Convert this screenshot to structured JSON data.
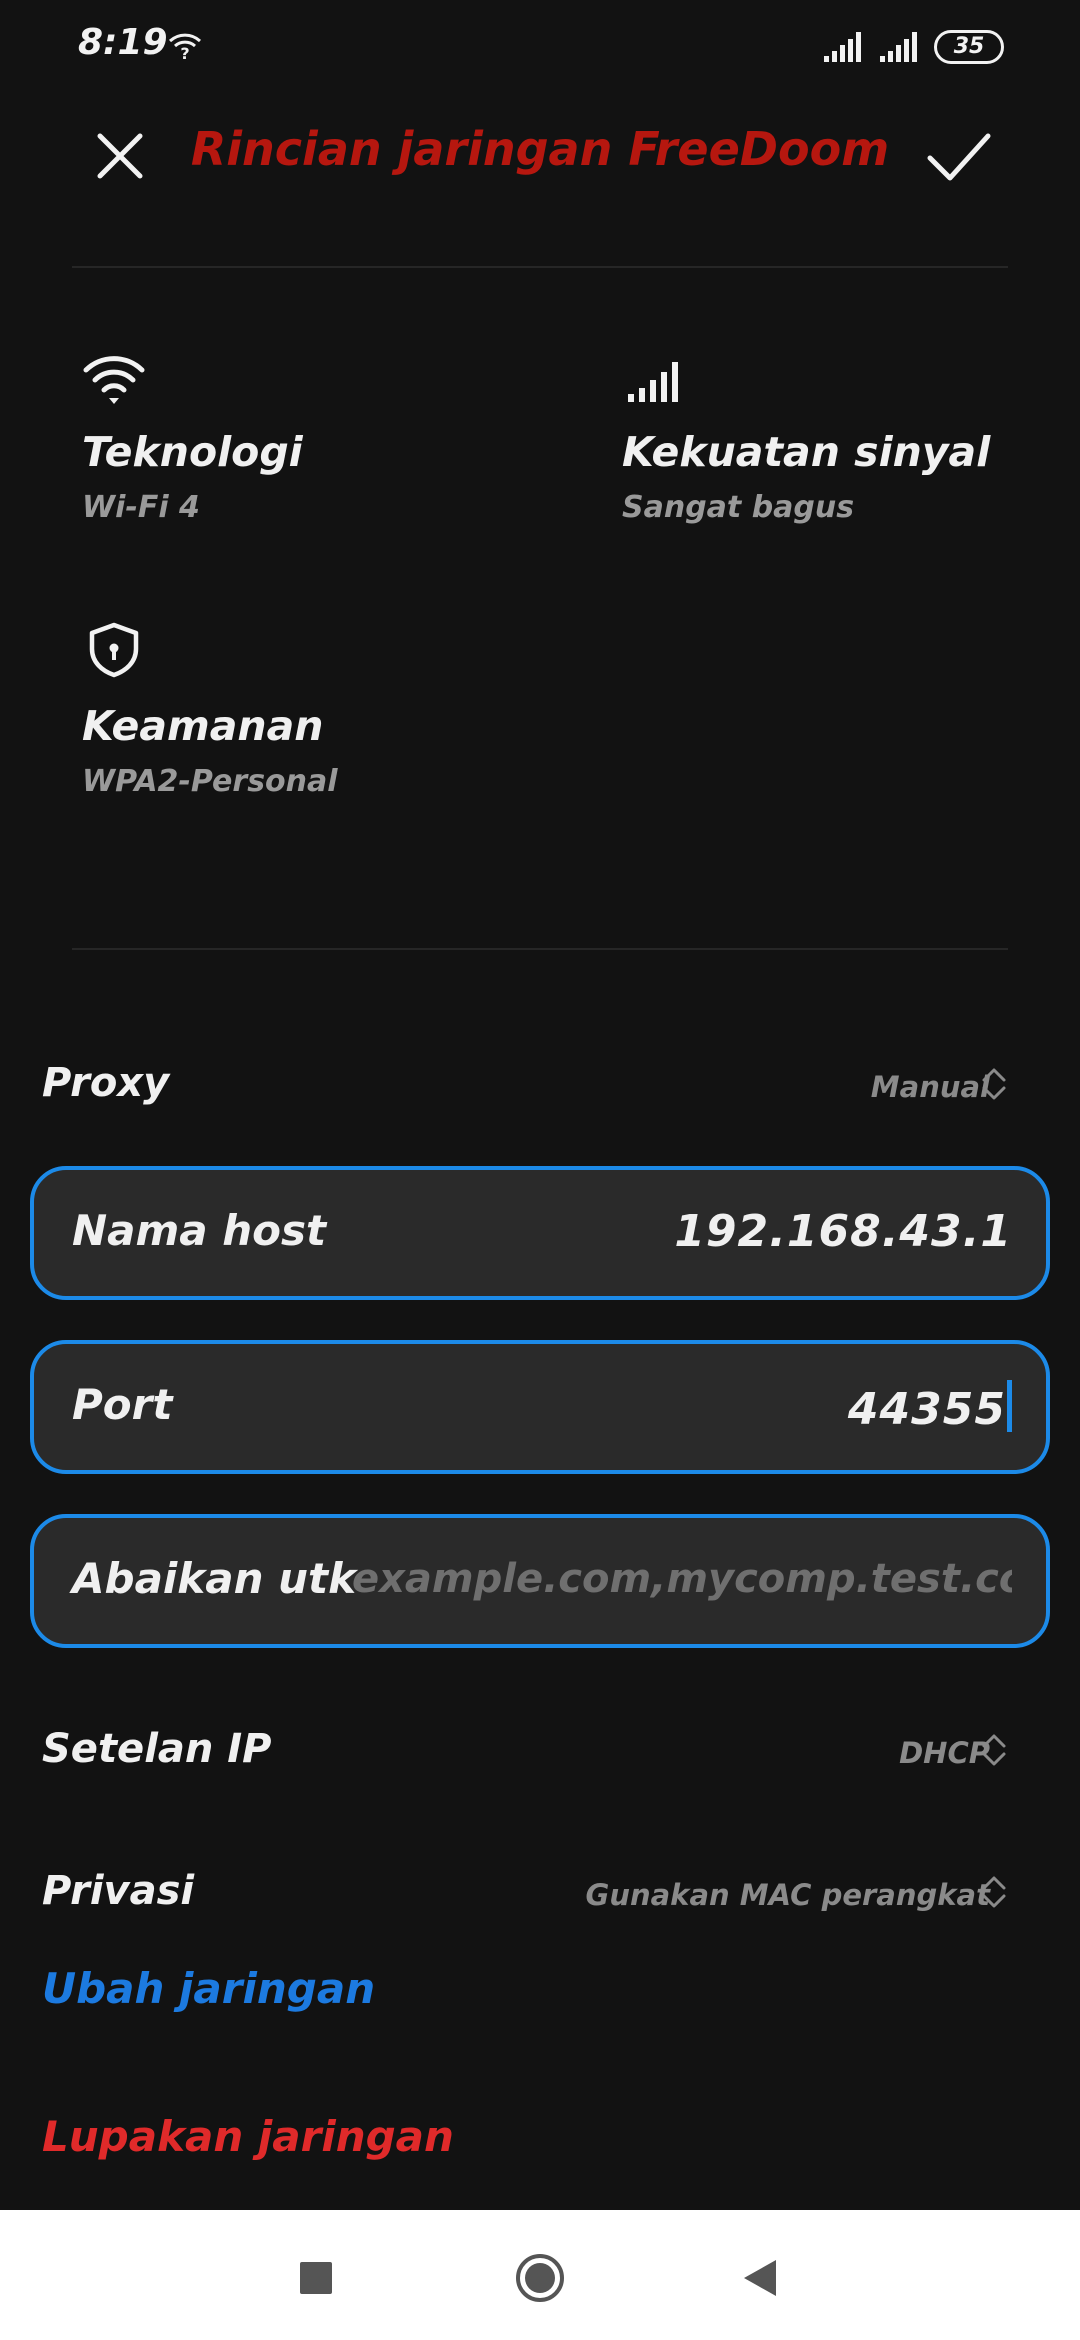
{
  "status_bar": {
    "time": "8:19",
    "battery": "35",
    "icons": [
      "wifi-unknown-icon",
      "cell-signal-icon",
      "cell-signal-icon",
      "battery-icon"
    ]
  },
  "app_bar": {
    "title": "Rincian jaringan FreeDoom",
    "close_icon": "close-icon",
    "confirm_icon": "check-icon",
    "title_color": "#b6170f"
  },
  "info": {
    "technology": {
      "label": "Teknologi",
      "value": "Wi-Fi 4",
      "icon": "wifi-icon"
    },
    "signal": {
      "label": "Kekuatan sinyal",
      "value": "Sangat bagus",
      "icon": "signal-strength-icon"
    },
    "security": {
      "label": "Keamanan",
      "value": "WPA2-Personal",
      "icon": "shield-icon"
    }
  },
  "proxy": {
    "label": "Proxy",
    "value": "Manual"
  },
  "fields": {
    "hostname": {
      "label": "Nama host",
      "value": "192.168.43.1"
    },
    "port": {
      "label": "Port",
      "value": "44355"
    },
    "bypass": {
      "label": "Abaikan utk",
      "placeholder": "example.com,mycomp.test.com,..."
    }
  },
  "ip_settings": {
    "label": "Setelan IP",
    "value": "DHCP"
  },
  "privacy": {
    "label": "Privasi",
    "value": "Gunakan MAC perangkat"
  },
  "actions": {
    "modify": "Ubah jaringan",
    "forget": "Lupakan jaringan"
  },
  "colors": {
    "accent": "#1c8ae8",
    "link_blue": "#1c7ae0",
    "danger": "#e02a2a",
    "background": "#121212"
  },
  "nav_bar": {
    "icons": [
      "recents-icon",
      "home-icon",
      "back-icon"
    ]
  }
}
